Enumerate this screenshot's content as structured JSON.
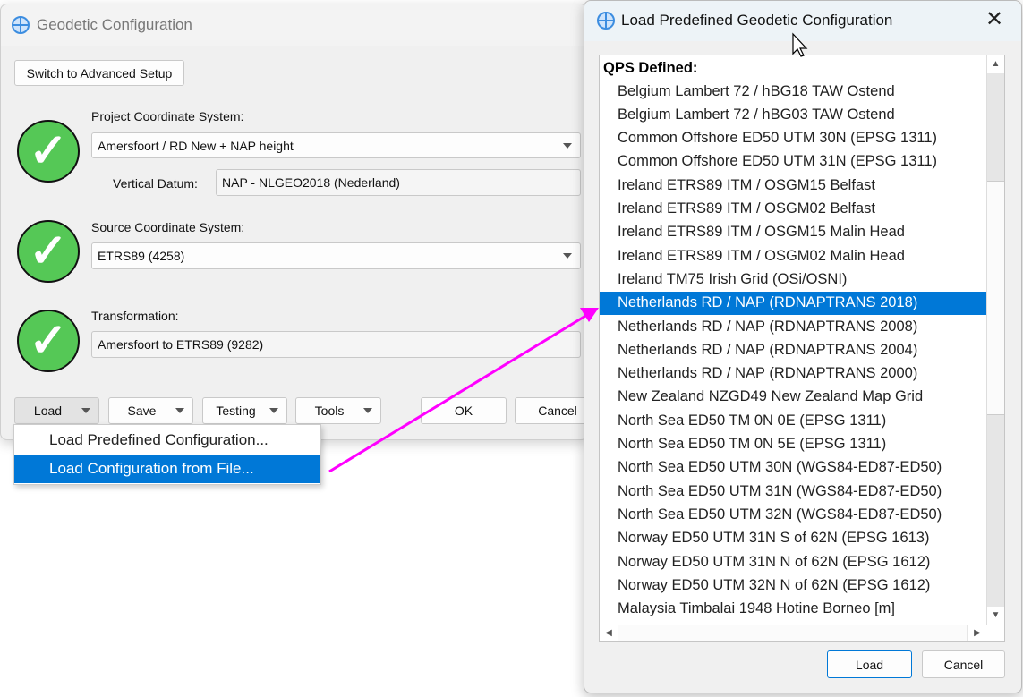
{
  "main_window": {
    "title": "Geodetic Configuration",
    "switch_button": "Switch to Advanced Setup",
    "project_cs": {
      "label": "Project Coordinate System:",
      "value": "Amersfoort / RD New + NAP height",
      "vertical_datum_label": "Vertical Datum:",
      "vertical_datum_value": "NAP - NLGEO2018 (Nederland)"
    },
    "source_cs": {
      "label": "Source Coordinate System:",
      "value": "ETRS89 (4258)"
    },
    "transformation": {
      "label": "Transformation:",
      "value": "Amersfoort to ETRS89 (9282)"
    },
    "buttons": {
      "load": "Load",
      "save": "Save",
      "testing": "Testing",
      "tools": "Tools",
      "ok": "OK",
      "cancel": "Cancel"
    }
  },
  "load_menu": {
    "items": [
      "Load Predefined Configuration...",
      "Load Configuration from File..."
    ],
    "highlighted": 1
  },
  "dialog": {
    "title": "Load Predefined Geodetic Configuration",
    "group_header": "QPS Defined:",
    "items": [
      "Belgium Lambert 72 / hBG18 TAW Ostend",
      "Belgium Lambert 72 / hBG03 TAW Ostend",
      "Common Offshore ED50 UTM 30N (EPSG 1311)",
      "Common Offshore ED50 UTM 31N (EPSG 1311)",
      "Ireland ETRS89 ITM / OSGM15 Belfast",
      "Ireland ETRS89 ITM / OSGM02 Belfast",
      "Ireland ETRS89 ITM / OSGM15 Malin Head",
      "Ireland ETRS89 ITM / OSGM02 Malin Head",
      "Ireland TM75 Irish Grid (OSi/OSNI)",
      "Netherlands RD / NAP (RDNAPTRANS 2018)",
      "Netherlands RD / NAP (RDNAPTRANS 2008)",
      "Netherlands RD / NAP (RDNAPTRANS 2004)",
      "Netherlands RD / NAP (RDNAPTRANS 2000)",
      "New Zealand NZGD49 New Zealand Map Grid",
      "North Sea ED50 TM 0N 0E (EPSG 1311)",
      "North Sea ED50 TM 0N 5E (EPSG 1311)",
      "North Sea ED50 UTM 30N (WGS84-ED87-ED50)",
      "North Sea ED50 UTM 31N (WGS84-ED87-ED50)",
      "North Sea ED50 UTM 32N (WGS84-ED87-ED50)",
      "Norway ED50 UTM 31N S of 62N (EPSG 1613)",
      "Norway ED50 UTM 31N N of 62N (EPSG 1612)",
      "Norway ED50 UTM 32N N of 62N (EPSG 1612)",
      "Malaysia Timbalai 1948 Hotine Borneo [m]"
    ],
    "selected_index": 9,
    "load_button": "Load",
    "cancel_button": "Cancel"
  },
  "colors": {
    "selection": "#0078d7",
    "annotation_arrow": "#ff00ff",
    "check": "#55c856"
  }
}
